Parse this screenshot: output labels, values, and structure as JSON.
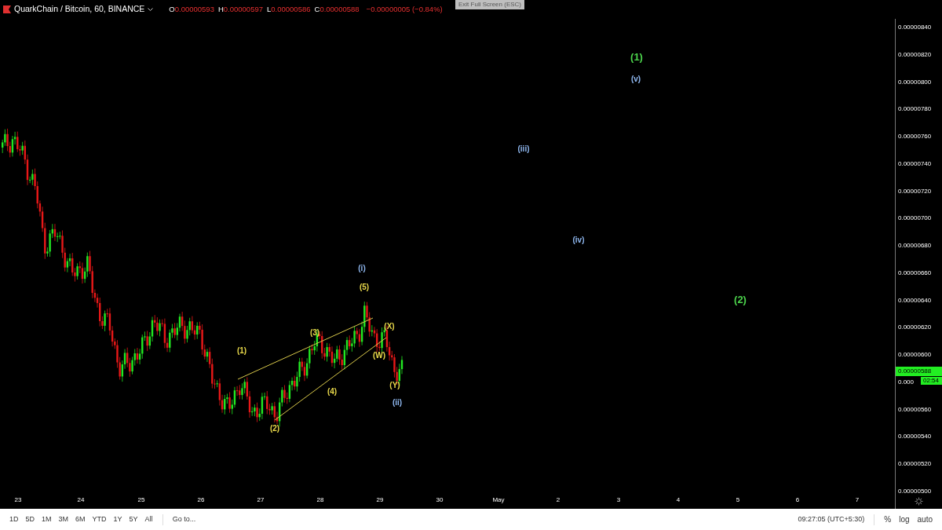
{
  "header": {
    "title": "QuarkChain / Bitcoin, 60, BINANCE",
    "ohlc": [
      {
        "label": "O",
        "value": "0.00000593"
      },
      {
        "label": "H",
        "value": "0.00000597"
      },
      {
        "label": "L",
        "value": "0.00000586"
      },
      {
        "label": "C",
        "value": "0.00000588"
      }
    ],
    "change": "−0.00000005 (−0.84%)"
  },
  "tooltip": "Exit Full Screen (ESC)",
  "wave_labels": [
    {
      "text": "(1)",
      "color": "#e8d84a"
    },
    {
      "text": "(2)",
      "color": "#e8d84a"
    },
    {
      "text": "(3)",
      "color": "#e8d84a"
    },
    {
      "text": "(4)",
      "color": "#e8d84a"
    },
    {
      "text": "(5)",
      "color": "#e8d84a"
    },
    {
      "text": "(X)",
      "color": "#e8d84a"
    },
    {
      "text": "(W)",
      "color": "#e8d84a"
    },
    {
      "text": "(Y)",
      "color": "#e8d84a"
    },
    {
      "text": "(i)",
      "color": "#8fb8f0"
    },
    {
      "text": "(ii)",
      "color": "#8fb8f0"
    },
    {
      "text": "(iii)",
      "color": "#8fb8f0"
    },
    {
      "text": "(iv)",
      "color": "#8fb8f0"
    },
    {
      "text": "(v)",
      "color": "#8fb8f0"
    },
    {
      "text": "(1)",
      "color": "#4cd44c"
    },
    {
      "text": "(2)",
      "color": "#4cd44c"
    }
  ],
  "price_axis": [
    "0.00000840",
    "0.00000820",
    "0.00000800",
    "0.00000780",
    "0.00000760",
    "0.00000740",
    "0.00000720",
    "0.00000700",
    "0.00000680",
    "0.00000660",
    "0.00000640",
    "0.00000620",
    "0.00000600",
    "0.000",
    "0.00000560",
    "0.00000540",
    "0.00000520",
    "0.00000500"
  ],
  "last_price": "0.00000588",
  "countdown": "02:54",
  "time_axis": [
    "23",
    "24",
    "25",
    "26",
    "27",
    "28",
    "29",
    "30",
    "May",
    "2",
    "3",
    "4",
    "5",
    "6",
    "7"
  ],
  "ranges": [
    "1D",
    "5D",
    "1M",
    "3M",
    "6M",
    "YTD",
    "1Y",
    "5Y",
    "All"
  ],
  "goto": "Go to...",
  "clock": "09:27:05 (UTC+5:30)",
  "scale_options": [
    "%",
    "log",
    "auto"
  ]
}
